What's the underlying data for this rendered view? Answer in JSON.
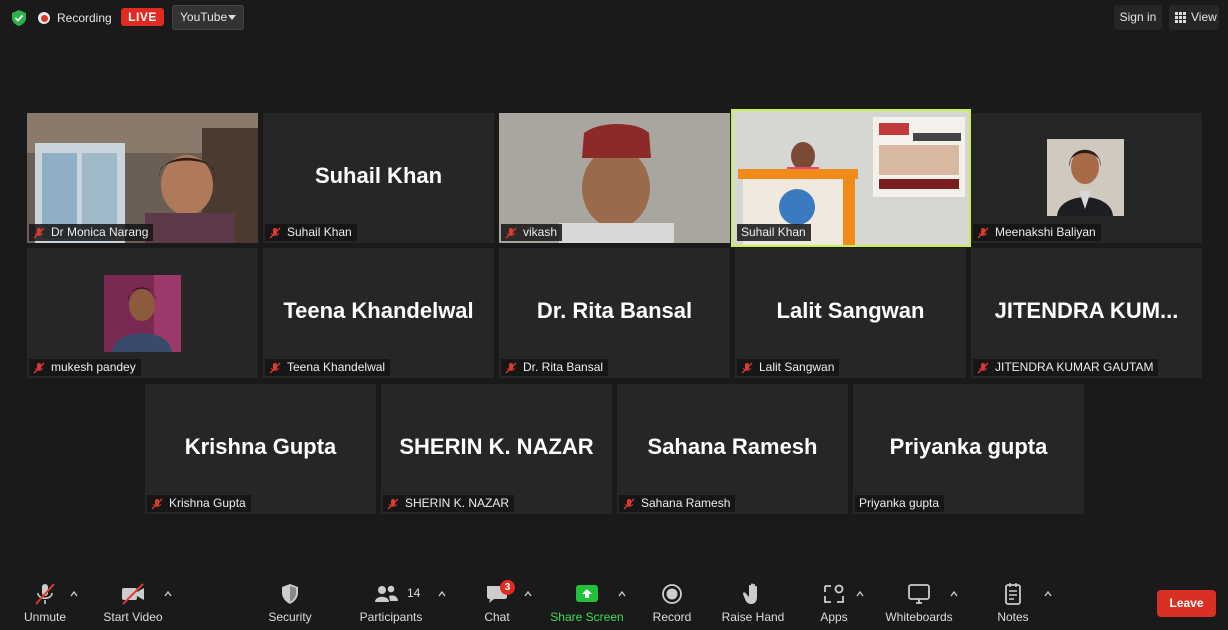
{
  "topbar": {
    "recording_label": "Recording",
    "live_label": "LIVE",
    "stream_target": "YouTube",
    "signin_label": "Sign in",
    "view_label": "View"
  },
  "tiles": [
    {
      "label": "Dr Monica Narang"
    },
    {
      "display_name": "Suhail Khan",
      "label": "Suhail Khan"
    },
    {
      "label": "vikash"
    },
    {
      "label": "Suhail Khan"
    },
    {
      "label": "Meenakshi Baliyan"
    },
    {
      "label": "mukesh pandey"
    },
    {
      "display_name": "Teena Khandelwal",
      "label": "Teena Khandelwal"
    },
    {
      "display_name": "Dr. Rita Bansal",
      "label": "Dr. Rita Bansal"
    },
    {
      "display_name": "Lalit Sangwan",
      "label": "Lalit Sangwan"
    },
    {
      "display_name": "JITENDRA  KUM...",
      "label": "JITENDRA KUMAR GAUTAM"
    },
    {
      "display_name": "Krishna Gupta",
      "label": "Krishna Gupta"
    },
    {
      "display_name": "SHERIN K. NAZAR",
      "label": "SHERIN K. NAZAR"
    },
    {
      "display_name": "Sahana Ramesh",
      "label": "Sahana Ramesh"
    },
    {
      "display_name": "Priyanka gupta",
      "label": "Priyanka gupta"
    }
  ],
  "toolbar": {
    "unmute": "Unmute",
    "start_video": "Start Video",
    "security": "Security",
    "participants": "Participants",
    "participants_count": "14",
    "chat": "Chat",
    "chat_badge": "3",
    "share_screen": "Share Screen",
    "record": "Record",
    "raise_hand": "Raise Hand",
    "apps": "Apps",
    "whiteboards": "Whiteboards",
    "notes": "Notes",
    "leave": "Leave"
  },
  "colors": {
    "background": "#1a1a1a",
    "tile": "#262626",
    "active_speaker": "#c9f04a",
    "live_red": "#e02b20",
    "share_green": "#3ddc4f",
    "leave_red": "#d93025"
  }
}
